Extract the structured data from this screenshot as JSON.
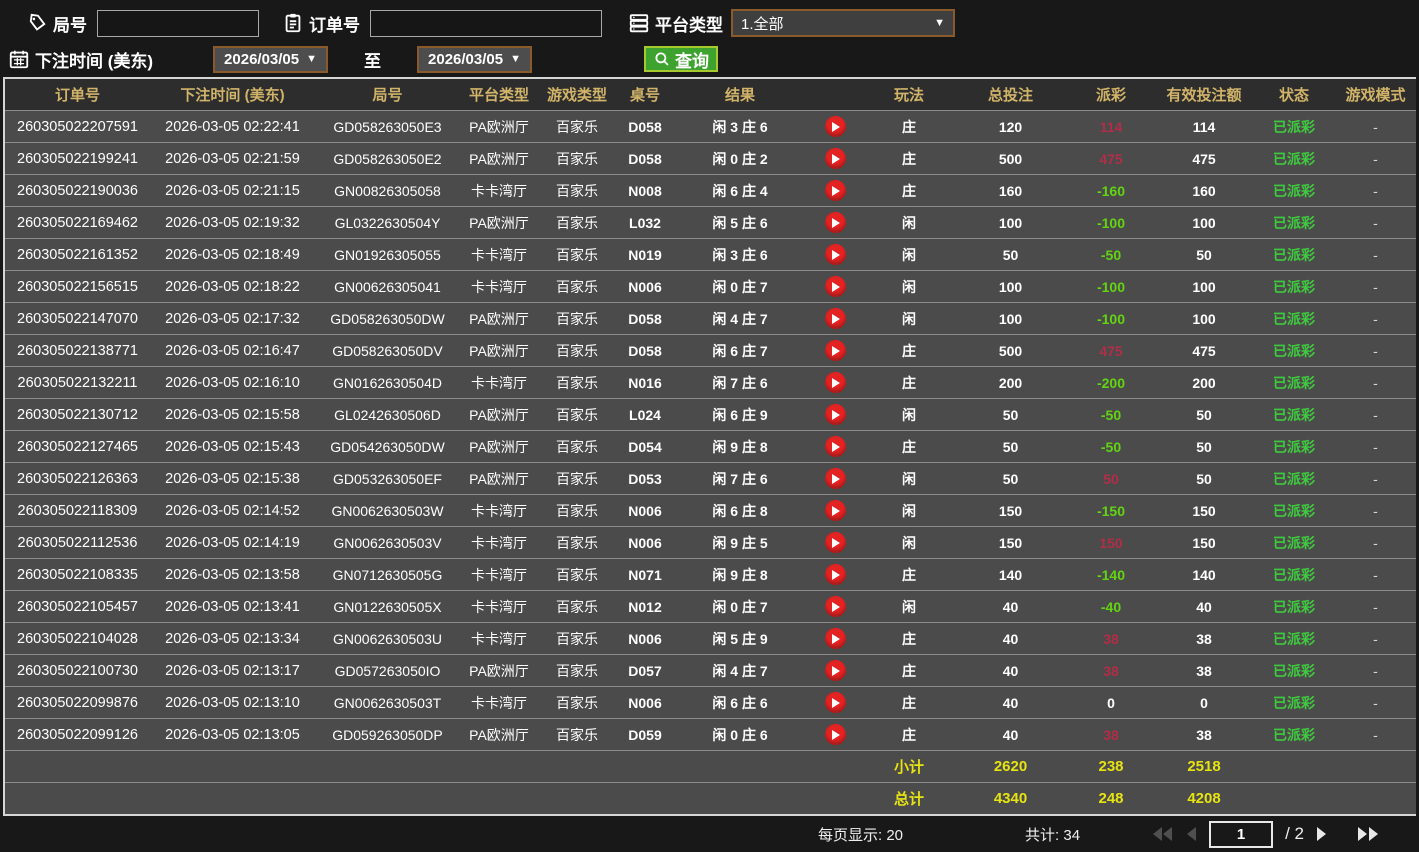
{
  "filters": {
    "round_label": "局号",
    "round_value": "",
    "order_label": "订单号",
    "order_value": "",
    "platform_label": "平台类型",
    "platform_value": "1.全部",
    "time_label": "下注时间 (美东)",
    "date_from": "2026/03/05",
    "to_label": "至",
    "date_to": "2026/03/05",
    "search_label": "查询"
  },
  "icons": {
    "round": "tag-icon",
    "order": "clipboard-icon",
    "platform": "list-icon",
    "time": "calendar-icon",
    "search": "magnifier-icon",
    "replay": "play-icon"
  },
  "colors": {
    "header_text": "#d1b469",
    "row_bg": "#4b4b4b",
    "header_bg": "#2d2d2d",
    "payout_positive": "#b02e48",
    "payout_negative": "#62d412",
    "status_green": "#3ecb3e",
    "summary_yellow": "#e6e312",
    "search_button_green": "#3ea22f",
    "date_border_brown": "#8a5a2a",
    "play_red": "#e32222"
  },
  "table": {
    "columns": [
      "订单号",
      "下注时间 (美东)",
      "局号",
      "平台类型",
      "游戏类型",
      "桌号",
      "结果",
      "",
      "玩法",
      "总投注",
      "派彩",
      "有效投注额",
      "状态",
      "游戏模式"
    ],
    "rows": [
      {
        "order": "260305022207591",
        "time": "2026-03-05 02:22:41",
        "round": "GD058263050E3",
        "platform": "PA欧洲厅",
        "game": "百家乐",
        "table": "D058",
        "result": "闲 3 庄 6",
        "side": "庄",
        "bet": "120",
        "payout": "114",
        "valid": "114",
        "status": "已派彩",
        "mode": "-"
      },
      {
        "order": "260305022199241",
        "time": "2026-03-05 02:21:59",
        "round": "GD058263050E2",
        "platform": "PA欧洲厅",
        "game": "百家乐",
        "table": "D058",
        "result": "闲 0 庄 2",
        "side": "庄",
        "bet": "500",
        "payout": "475",
        "valid": "475",
        "status": "已派彩",
        "mode": "-"
      },
      {
        "order": "260305022190036",
        "time": "2026-03-05 02:21:15",
        "round": "GN00826305058",
        "platform": "卡卡湾厅",
        "game": "百家乐",
        "table": "N008",
        "result": "闲 6 庄 4",
        "side": "庄",
        "bet": "160",
        "payout": "-160",
        "valid": "160",
        "status": "已派彩",
        "mode": "-"
      },
      {
        "order": "260305022169462",
        "time": "2026-03-05 02:19:32",
        "round": "GL0322630504Y",
        "platform": "PA欧洲厅",
        "game": "百家乐",
        "table": "L032",
        "result": "闲 5 庄 6",
        "side": "闲",
        "bet": "100",
        "payout": "-100",
        "valid": "100",
        "status": "已派彩",
        "mode": "-"
      },
      {
        "order": "260305022161352",
        "time": "2026-03-05 02:18:49",
        "round": "GN01926305055",
        "platform": "卡卡湾厅",
        "game": "百家乐",
        "table": "N019",
        "result": "闲 3 庄 6",
        "side": "闲",
        "bet": "50",
        "payout": "-50",
        "valid": "50",
        "status": "已派彩",
        "mode": "-"
      },
      {
        "order": "260305022156515",
        "time": "2026-03-05 02:18:22",
        "round": "GN00626305041",
        "platform": "卡卡湾厅",
        "game": "百家乐",
        "table": "N006",
        "result": "闲 0 庄 7",
        "side": "闲",
        "bet": "100",
        "payout": "-100",
        "valid": "100",
        "status": "已派彩",
        "mode": "-"
      },
      {
        "order": "260305022147070",
        "time": "2026-03-05 02:17:32",
        "round": "GD058263050DW",
        "platform": "PA欧洲厅",
        "game": "百家乐",
        "table": "D058",
        "result": "闲 4 庄 7",
        "side": "闲",
        "bet": "100",
        "payout": "-100",
        "valid": "100",
        "status": "已派彩",
        "mode": "-"
      },
      {
        "order": "260305022138771",
        "time": "2026-03-05 02:16:47",
        "round": "GD058263050DV",
        "platform": "PA欧洲厅",
        "game": "百家乐",
        "table": "D058",
        "result": "闲 6 庄 7",
        "side": "庄",
        "bet": "500",
        "payout": "475",
        "valid": "475",
        "status": "已派彩",
        "mode": "-"
      },
      {
        "order": "260305022132211",
        "time": "2026-03-05 02:16:10",
        "round": "GN0162630504D",
        "platform": "卡卡湾厅",
        "game": "百家乐",
        "table": "N016",
        "result": "闲 7 庄 6",
        "side": "庄",
        "bet": "200",
        "payout": "-200",
        "valid": "200",
        "status": "已派彩",
        "mode": "-"
      },
      {
        "order": "260305022130712",
        "time": "2026-03-05 02:15:58",
        "round": "GL0242630506D",
        "platform": "PA欧洲厅",
        "game": "百家乐",
        "table": "L024",
        "result": "闲 6 庄 9",
        "side": "闲",
        "bet": "50",
        "payout": "-50",
        "valid": "50",
        "status": "已派彩",
        "mode": "-"
      },
      {
        "order": "260305022127465",
        "time": "2026-03-05 02:15:43",
        "round": "GD054263050DW",
        "platform": "PA欧洲厅",
        "game": "百家乐",
        "table": "D054",
        "result": "闲 9 庄 8",
        "side": "庄",
        "bet": "50",
        "payout": "-50",
        "valid": "50",
        "status": "已派彩",
        "mode": "-"
      },
      {
        "order": "260305022126363",
        "time": "2026-03-05 02:15:38",
        "round": "GD053263050EF",
        "platform": "PA欧洲厅",
        "game": "百家乐",
        "table": "D053",
        "result": "闲 7 庄 6",
        "side": "闲",
        "bet": "50",
        "payout": "50",
        "valid": "50",
        "status": "已派彩",
        "mode": "-"
      },
      {
        "order": "260305022118309",
        "time": "2026-03-05 02:14:52",
        "round": "GN0062630503W",
        "platform": "卡卡湾厅",
        "game": "百家乐",
        "table": "N006",
        "result": "闲 6 庄 8",
        "side": "闲",
        "bet": "150",
        "payout": "-150",
        "valid": "150",
        "status": "已派彩",
        "mode": "-"
      },
      {
        "order": "260305022112536",
        "time": "2026-03-05 02:14:19",
        "round": "GN0062630503V",
        "platform": "卡卡湾厅",
        "game": "百家乐",
        "table": "N006",
        "result": "闲 9 庄 5",
        "side": "闲",
        "bet": "150",
        "payout": "150",
        "valid": "150",
        "status": "已派彩",
        "mode": "-"
      },
      {
        "order": "260305022108335",
        "time": "2026-03-05 02:13:58",
        "round": "GN0712630505G",
        "platform": "卡卡湾厅",
        "game": "百家乐",
        "table": "N071",
        "result": "闲 9 庄 8",
        "side": "庄",
        "bet": "140",
        "payout": "-140",
        "valid": "140",
        "status": "已派彩",
        "mode": "-"
      },
      {
        "order": "260305022105457",
        "time": "2026-03-05 02:13:41",
        "round": "GN0122630505X",
        "platform": "卡卡湾厅",
        "game": "百家乐",
        "table": "N012",
        "result": "闲 0 庄 7",
        "side": "闲",
        "bet": "40",
        "payout": "-40",
        "valid": "40",
        "status": "已派彩",
        "mode": "-"
      },
      {
        "order": "260305022104028",
        "time": "2026-03-05 02:13:34",
        "round": "GN0062630503U",
        "platform": "卡卡湾厅",
        "game": "百家乐",
        "table": "N006",
        "result": "闲 5 庄 9",
        "side": "庄",
        "bet": "40",
        "payout": "38",
        "valid": "38",
        "status": "已派彩",
        "mode": "-"
      },
      {
        "order": "260305022100730",
        "time": "2026-03-05 02:13:17",
        "round": "GD057263050IO",
        "platform": "PA欧洲厅",
        "game": "百家乐",
        "table": "D057",
        "result": "闲 4 庄 7",
        "side": "庄",
        "bet": "40",
        "payout": "38",
        "valid": "38",
        "status": "已派彩",
        "mode": "-"
      },
      {
        "order": "260305022099876",
        "time": "2026-03-05 02:13:10",
        "round": "GN0062630503T",
        "platform": "卡卡湾厅",
        "game": "百家乐",
        "table": "N006",
        "result": "闲 6 庄 6",
        "side": "庄",
        "bet": "40",
        "payout": "0",
        "valid": "0",
        "status": "已派彩",
        "mode": "-"
      },
      {
        "order": "260305022099126",
        "time": "2026-03-05 02:13:05",
        "round": "GD059263050DP",
        "platform": "PA欧洲厅",
        "game": "百家乐",
        "table": "D059",
        "result": "闲 0 庄 6",
        "side": "庄",
        "bet": "40",
        "payout": "38",
        "valid": "38",
        "status": "已派彩",
        "mode": "-"
      }
    ],
    "subtotal": {
      "label": "小计",
      "bet": "2620",
      "payout": "238",
      "valid": "2518"
    },
    "total": {
      "label": "总计",
      "bet": "4340",
      "payout": "248",
      "valid": "4208"
    }
  },
  "footer": {
    "per_page_label": "每页显示: 20",
    "total_count_label": "共计: 34",
    "current_page": "1",
    "page_sep": "/",
    "total_pages": "2"
  }
}
